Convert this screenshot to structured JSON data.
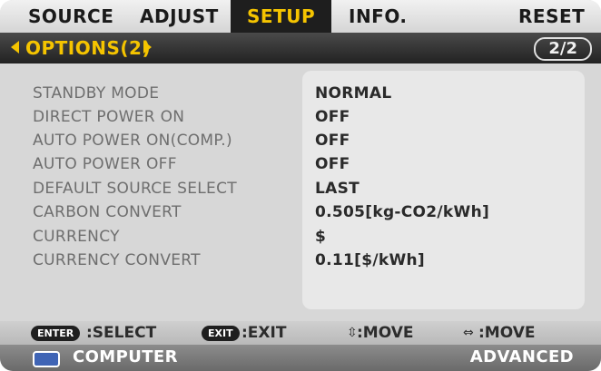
{
  "tabs": [
    {
      "label": "SOURCE"
    },
    {
      "label": "ADJUST"
    },
    {
      "label": "SETUP",
      "active": true
    },
    {
      "label": "INFO."
    },
    {
      "label": "RESET"
    }
  ],
  "submenu": {
    "title": "OPTIONS(2)",
    "page": "2/2"
  },
  "settings": [
    {
      "label": "STANDBY MODE",
      "value": "NORMAL"
    },
    {
      "label": "DIRECT POWER ON",
      "value": "OFF"
    },
    {
      "label": "AUTO POWER ON(COMP.)",
      "value": "OFF"
    },
    {
      "label": "AUTO POWER OFF",
      "value": "OFF"
    },
    {
      "label": "DEFAULT SOURCE SELECT",
      "value": "LAST"
    },
    {
      "label": "CARBON CONVERT",
      "value": "0.505[kg-CO2/kWh]"
    },
    {
      "label": "CURRENCY",
      "value": "$"
    },
    {
      "label": "CURRENCY CONVERT",
      "value": "0.11[$/kWh]"
    }
  ],
  "hints": {
    "enter_key": "ENTER",
    "select": ":SELECT",
    "exit_key": "EXIT",
    "exit": ":EXIT",
    "move_updown_icon": "updown-arrow-icon",
    "move_updown": ":MOVE",
    "move_leftright_icon": "leftright-arrow-icon",
    "move_leftright": ":MOVE"
  },
  "status": {
    "source": "COMPUTER",
    "mode": "ADVANCED"
  },
  "colors": {
    "accent": "#f5c400",
    "active_tab_bg": "#1e1e1e",
    "source_icon": "#3f64b5"
  }
}
